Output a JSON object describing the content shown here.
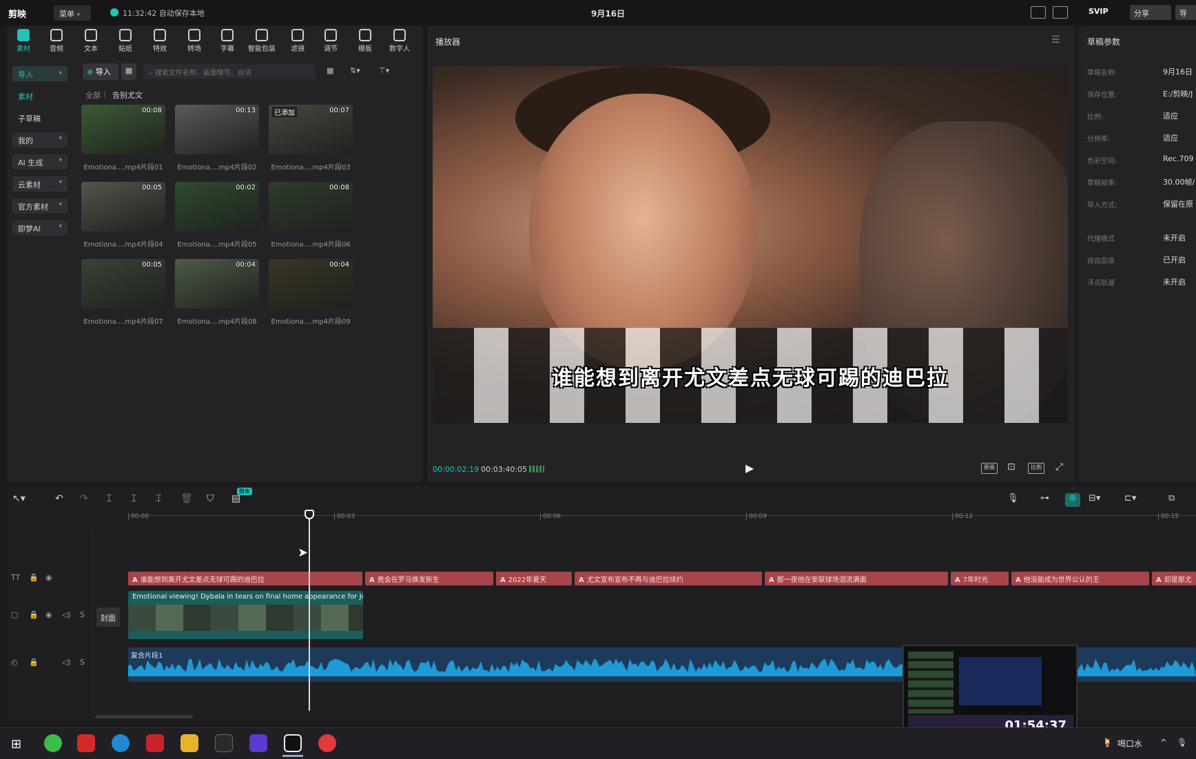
{
  "titlebar": {
    "app_name": "剪映",
    "menu": "菜单",
    "autosave": "11:32:42 自动保存本地",
    "project_title": "9月16日",
    "svip": "SVIP",
    "share": "分享",
    "export": "导"
  },
  "toolbar": [
    {
      "label": "素材",
      "icon": "media-icon"
    },
    {
      "label": "音频",
      "icon": "audio-icon"
    },
    {
      "label": "文本",
      "icon": "text-icon"
    },
    {
      "label": "贴纸",
      "icon": "sticker-icon"
    },
    {
      "label": "特效",
      "icon": "effects-icon"
    },
    {
      "label": "转场",
      "icon": "transition-icon"
    },
    {
      "label": "字幕",
      "icon": "caption-icon"
    },
    {
      "label": "智能包装",
      "icon": "smart-pack-icon"
    },
    {
      "label": "滤镜",
      "icon": "filter-icon"
    },
    {
      "label": "调节",
      "icon": "adjust-icon"
    },
    {
      "label": "模板",
      "icon": "template-icon"
    },
    {
      "label": "数字人",
      "icon": "avatar-icon"
    }
  ],
  "sidebar": [
    {
      "label": "导入",
      "style": "sel-chev"
    },
    {
      "label": "素材",
      "style": "sel"
    },
    {
      "label": "子草稿",
      "style": "plain"
    },
    {
      "label": "我的",
      "style": "dark"
    },
    {
      "label": "AI 生成",
      "style": "dark"
    },
    {
      "label": "云素材",
      "style": "dark"
    },
    {
      "label": "官方素材",
      "style": "dark"
    },
    {
      "label": "即梦AI",
      "style": "dark"
    }
  ],
  "media": {
    "import_label": "导入",
    "search_placeholder": "搜索文件名称、画面情节、台词",
    "breadcrumb_all": "全部",
    "breadcrumb_current": "告别尤文",
    "added_badge": "已添加",
    "items": [
      {
        "name": "Emotiona....mp4片段01",
        "duration": "00:08"
      },
      {
        "name": "Emotiona....mp4片段02",
        "duration": "00:13"
      },
      {
        "name": "Emotiona....mp4片段03",
        "duration": "00:07"
      },
      {
        "name": "Emotiona....mp4片段04",
        "duration": "00:05"
      },
      {
        "name": "Emotiona....mp4片段05",
        "duration": "00:02"
      },
      {
        "name": "Emotiona....mp4片段06",
        "duration": "00:08"
      },
      {
        "name": "Emotiona....mp4片段07",
        "duration": "00:05"
      },
      {
        "name": "Emotiona....mp4片段08",
        "duration": "00:04"
      },
      {
        "name": "Emotiona....mp4片段09",
        "duration": "00:04"
      }
    ]
  },
  "player": {
    "title": "播放器",
    "subtitle": "谁能想到离开尤文差点无球可踢的迪巴拉",
    "current_time": "00:00:02:19",
    "total_time": "00:03:40:05",
    "buttons": [
      "原画",
      "比例"
    ]
  },
  "props": {
    "title": "草稿参数",
    "rows": [
      {
        "label": "草稿名称:",
        "value": "9月16日"
      },
      {
        "label": "保存位置:",
        "value": "E:/剪映/J"
      },
      {
        "label": "比例:",
        "value": "适应"
      },
      {
        "label": "分辨率:",
        "value": "适应"
      },
      {
        "label": "色彩空间:",
        "value": "Rec.709"
      },
      {
        "label": "草稿帧率:",
        "value": "30.00帧/"
      },
      {
        "label": "导入方式:",
        "value": "保留在原"
      },
      {
        "label": "代理模式",
        "value": "未开启"
      },
      {
        "label": "自由层级",
        "value": "已开启"
      },
      {
        "label": "浮点轨道",
        "value": "未开启"
      }
    ]
  },
  "timeline": {
    "ruler": [
      "00:00",
      "00:03",
      "00:06",
      "00:09",
      "00:12",
      "00:15"
    ],
    "text_clips": [
      "谁能想到离开尤文差点无球可踢的迪巴拉",
      "竟会在罗马焕发新生",
      "2022年夏天",
      "尤文宣布宣布不再与迪巴拉续约",
      "那一夜他在安联球场泪流满面",
      "7年时光",
      "他没能成为世界公认的王",
      "却是那尤"
    ],
    "video_clip_title": "Emotional viewing! Dybala in tears on final home appearance for Juv",
    "cover_label": "封面",
    "audio_clip_title": "复合片段1",
    "badge": "限免",
    "pip_time": "01:54:37"
  },
  "taskbar": {
    "tray_text": "喝口水"
  }
}
